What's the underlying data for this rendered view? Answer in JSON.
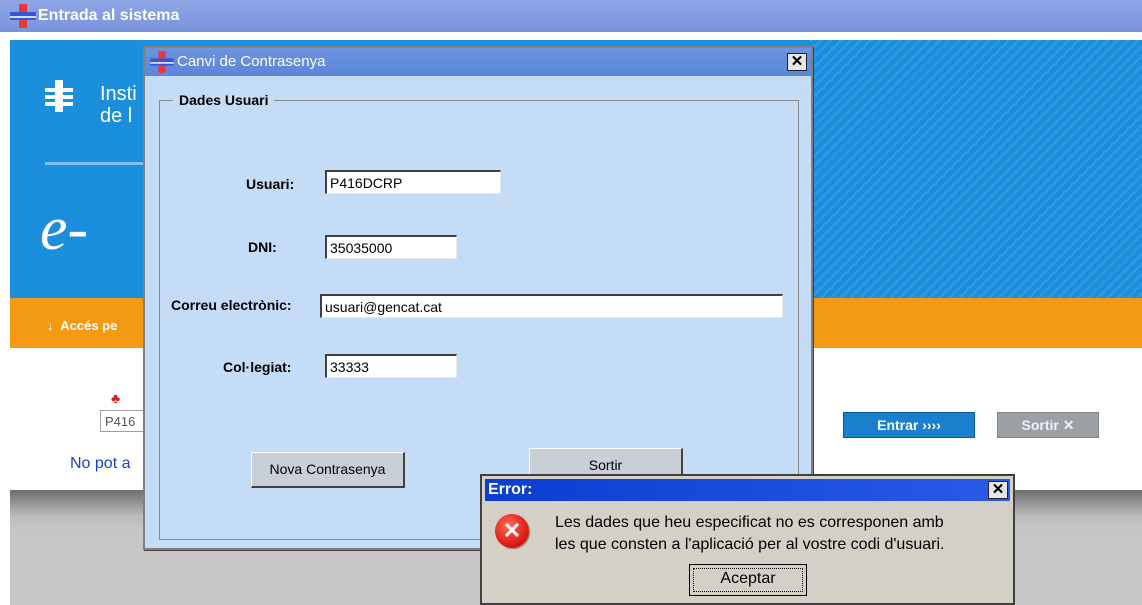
{
  "main_window": {
    "title": "Entrada al sistema"
  },
  "background": {
    "institution_text_line1": "Insti",
    "institution_text_line2": "de l",
    "logo_text": "e-",
    "access_bar_text": "Accés pe",
    "user_input_value": "P416",
    "forgot_link": "No pot a",
    "enter_button": "Entrar ››››",
    "exit_button": "Sortir ✕"
  },
  "change_password_dialog": {
    "title": "Canvi de Contrasenya",
    "close_glyph": "✕",
    "group_title": "Dades Usuari",
    "fields": {
      "usuari": {
        "label": "Usuari:",
        "value": "P416DCRP"
      },
      "dni": {
        "label": "DNI:",
        "value": "35035000"
      },
      "email": {
        "label": "Correu electrònic:",
        "value": "usuari@gencat.cat"
      },
      "collegiat": {
        "label": "Col·legiat:",
        "value": "33333"
      }
    },
    "new_password_button": "Nova Contrasenya",
    "exit_button": "Sortir"
  },
  "error_dialog": {
    "title": "Error:",
    "close_glyph": "✕",
    "icon_glyph": "✕",
    "message_line1": "Les dades que heu especificat no es corresponen amb",
    "message_line2": "les que consten a l'aplicació per al vostre codi d'usuari.",
    "ok_button": "Aceptar"
  },
  "colors": {
    "banner_blue": "#1b8fdc",
    "orange_bar": "#f49a12",
    "dialog_bg": "#c5dcf6",
    "error_title_blue": "#0a3ed0"
  }
}
